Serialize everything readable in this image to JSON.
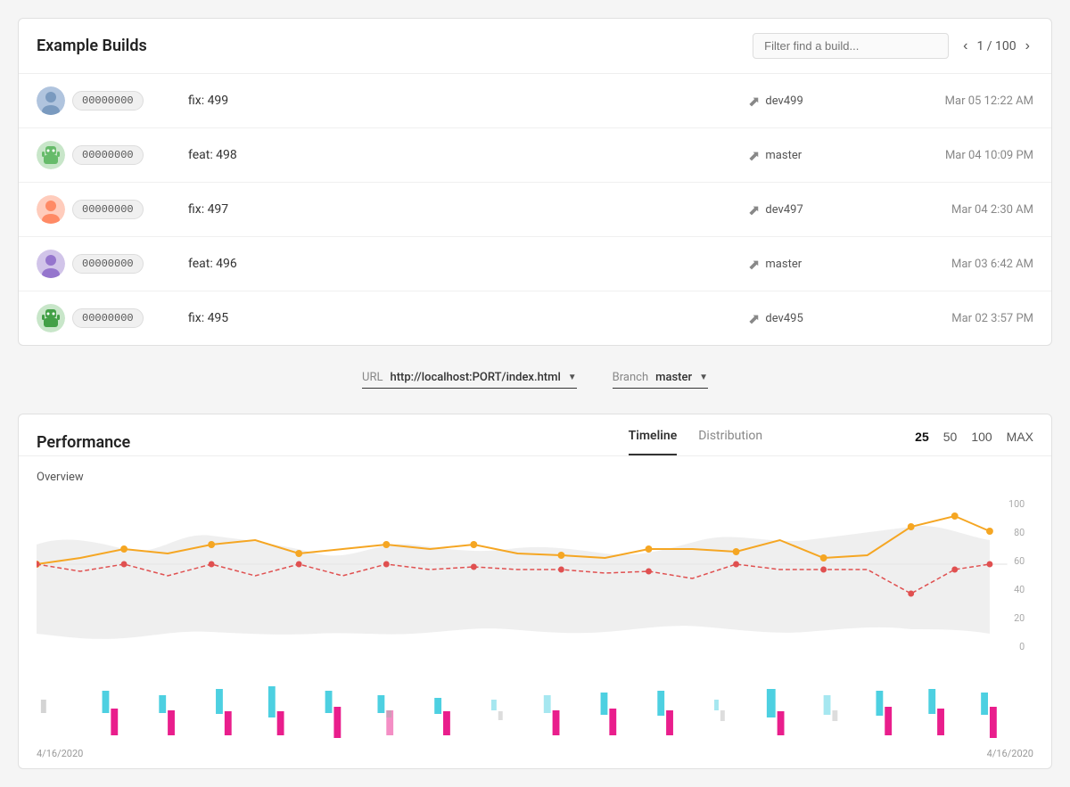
{
  "builds": {
    "title": "Example Builds",
    "filter_placeholder": "Filter find a build...",
    "pagination": {
      "current": 1,
      "total": 100,
      "display": "1 / 100"
    },
    "rows": [
      {
        "id": "00000000",
        "message": "fix: 499",
        "branch": "dev499",
        "date": "Mar 05 12:22 AM",
        "avatar_type": "person"
      },
      {
        "id": "00000000",
        "message": "feat: 498",
        "branch": "master",
        "date": "Mar 04 10:09 PM",
        "avatar_type": "bot"
      },
      {
        "id": "00000000",
        "message": "fix: 497",
        "branch": "dev497",
        "date": "Mar 04 2:30 AM",
        "avatar_type": "person"
      },
      {
        "id": "00000000",
        "message": "feat: 496",
        "branch": "master",
        "date": "Mar 03 6:42 AM",
        "avatar_type": "person"
      },
      {
        "id": "00000000",
        "message": "fix: 495",
        "branch": "dev495",
        "date": "Mar 02 3:57 PM",
        "avatar_type": "bot"
      }
    ]
  },
  "selectors": {
    "url_label": "URL",
    "url_value": "http://localhost:PORT/index.html",
    "branch_label": "Branch",
    "branch_value": "master"
  },
  "performance": {
    "title": "Performance",
    "tabs": [
      {
        "label": "Timeline",
        "active": true
      },
      {
        "label": "Distribution",
        "active": false
      }
    ],
    "range_buttons": [
      {
        "label": "25",
        "active": true
      },
      {
        "label": "50",
        "active": false
      },
      {
        "label": "100",
        "active": false
      },
      {
        "label": "MAX",
        "active": false
      }
    ],
    "overview_label": "Overview",
    "chart_dates": {
      "start": "4/16/2020",
      "end": "4/16/2020"
    },
    "y_axis_labels": [
      "100",
      "80",
      "60",
      "40",
      "20",
      "0"
    ]
  }
}
